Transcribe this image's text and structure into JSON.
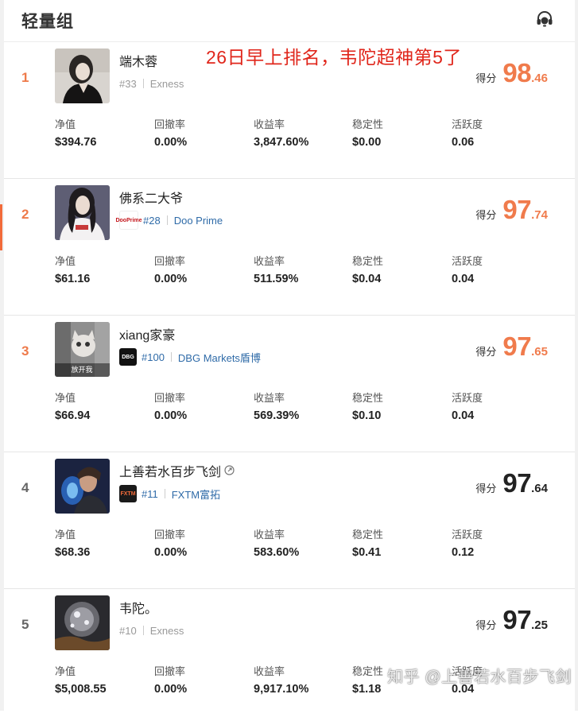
{
  "header": {
    "title": "轻量组"
  },
  "annotation": "26日早上排名，韦陀超神第5了",
  "watermark": "知乎 @上善若水百步飞剑",
  "stat_labels": [
    "净值",
    "回撤率",
    "收益率",
    "稳定性",
    "活跃度"
  ],
  "score_label": "得分",
  "entries": [
    {
      "rank": "1",
      "name": "端木蓉",
      "account": "#33",
      "broker": "Exness",
      "score_int": "98",
      "score_dec": ".46",
      "stats": [
        "$394.76",
        "0.00%",
        "3,847.60%",
        "$0.00",
        "0.06"
      ]
    },
    {
      "rank": "2",
      "name": "佛系二大爷",
      "account": "#28",
      "broker": "Doo Prime",
      "broker_logo_text": "DooPrime",
      "score_int": "97",
      "score_dec": ".74",
      "stats": [
        "$61.16",
        "0.00%",
        "511.59%",
        "$0.04",
        "0.04"
      ]
    },
    {
      "rank": "3",
      "name": "xiang家豪",
      "account": "#100",
      "broker": "DBG Markets盾博",
      "broker_logo_text": "DBG",
      "avatar_caption": "放开我",
      "score_int": "97",
      "score_dec": ".65",
      "stats": [
        "$66.94",
        "0.00%",
        "569.39%",
        "$0.10",
        "0.04"
      ]
    },
    {
      "rank": "4",
      "name": "上善若水百步飞剑",
      "account": "#11",
      "broker": "FXTM富拓",
      "broker_logo_text": "FXTM",
      "score_int": "97",
      "score_dec": ".64",
      "stats": [
        "$68.36",
        "0.00%",
        "583.60%",
        "$0.41",
        "0.12"
      ]
    },
    {
      "rank": "5",
      "name": "韦陀。",
      "account": "#10",
      "broker": "Exness",
      "score_int": "97",
      "score_dec": ".25",
      "stats": [
        "$5,008.55",
        "0.00%",
        "9,917.10%",
        "$1.18",
        "0.04"
      ]
    }
  ],
  "colors": {
    "accent": "#f07b4c",
    "link": "#2f6ba8",
    "annotation": "#e0261b"
  }
}
